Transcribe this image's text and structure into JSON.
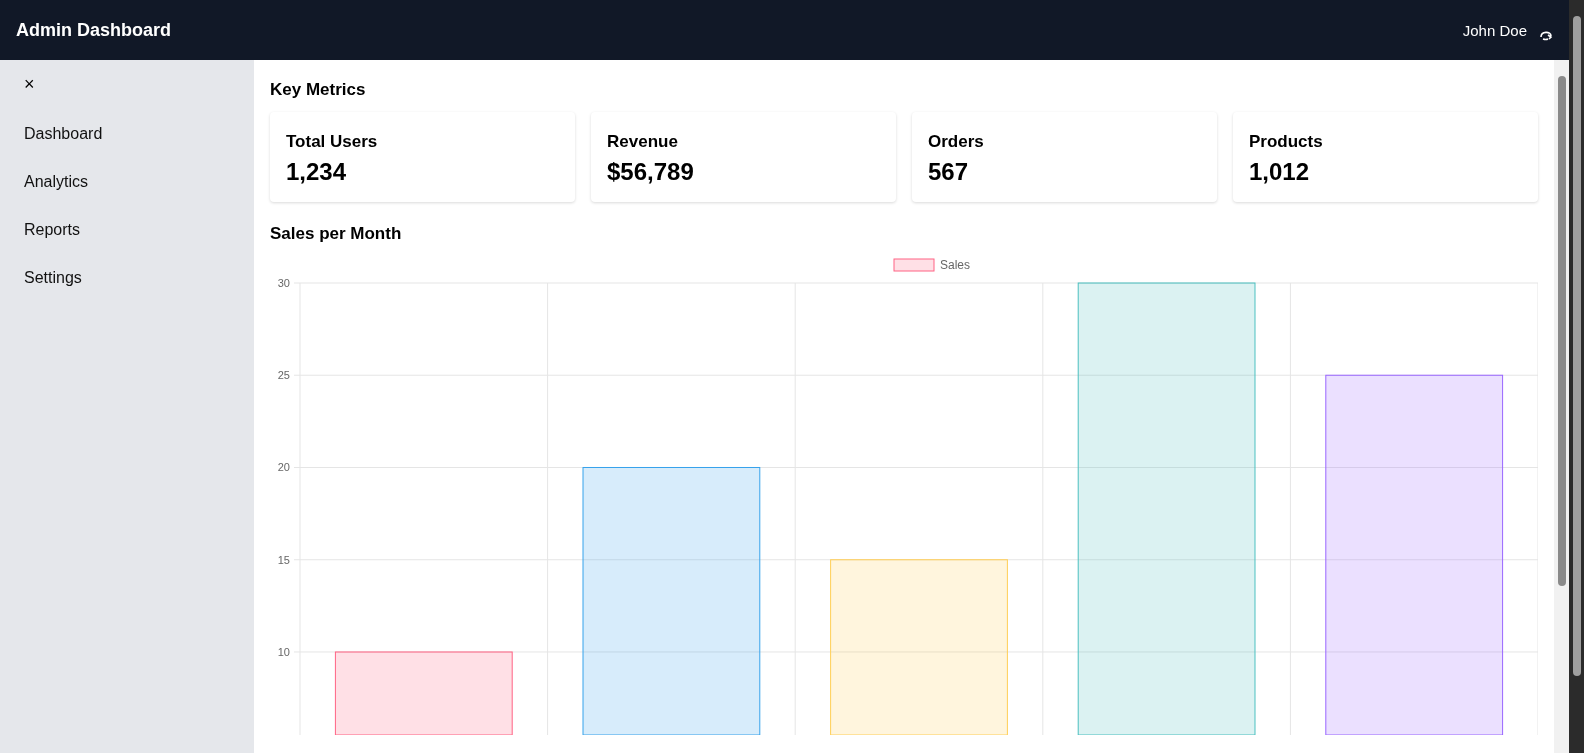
{
  "header": {
    "title": "Admin Dashboard",
    "user": "John Doe"
  },
  "sidebar": {
    "close": "×",
    "items": [
      {
        "label": "Dashboard"
      },
      {
        "label": "Analytics"
      },
      {
        "label": "Reports"
      },
      {
        "label": "Settings"
      }
    ]
  },
  "metrics": {
    "title": "Key Metrics",
    "cards": [
      {
        "label": "Total Users",
        "value": "1,234"
      },
      {
        "label": "Revenue",
        "value": "$56,789"
      },
      {
        "label": "Orders",
        "value": "567"
      },
      {
        "label": "Products",
        "value": "1,012"
      }
    ]
  },
  "sales": {
    "title": "Sales per Month",
    "chart_data": {
      "type": "bar",
      "grid": true,
      "ylim": [
        5.5,
        30
      ],
      "yticks": [
        10,
        15,
        20,
        25,
        30
      ],
      "series": [
        {
          "name": "Sales",
          "color": "#ff6384",
          "colors": [
            "#ff6384",
            "#36a2eb",
            "#ffce56",
            "#4bc0c0",
            "#9966ff"
          ],
          "values": [
            10,
            20,
            15,
            30,
            25
          ]
        }
      ]
    }
  }
}
